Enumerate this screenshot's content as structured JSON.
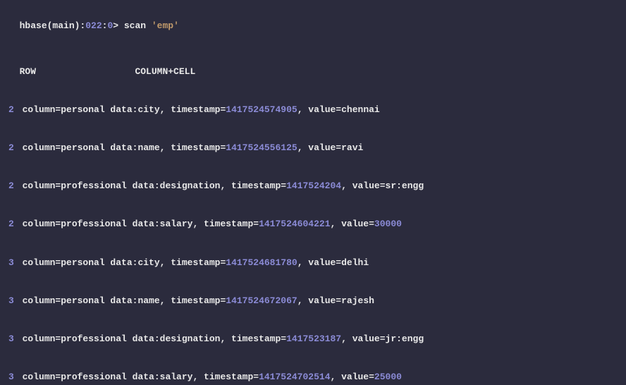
{
  "prompt": {
    "prefix": "hbase(main):",
    "seq": "022",
    "sep": ":",
    "zero": "0",
    "arrow": "> scan ",
    "arg": "'emp'"
  },
  "header": {
    "row": "ROW",
    "colcell": "COLUMN+CELL"
  },
  "rows": [
    {
      "r": "2",
      "cf": "personal data",
      "q": "city",
      "ts": "1417524574905",
      "val": "chennai",
      "valIsNum": false
    },
    {
      "r": "2",
      "cf": "personal data",
      "q": "name",
      "ts": "1417524556125",
      "val": "ravi",
      "valIsNum": false
    },
    {
      "r": "2",
      "cf": "professional data",
      "q": "designation",
      "ts": "1417524204",
      "val": "sr:engg",
      "valIsNum": false
    },
    {
      "r": "2",
      "cf": "professional data",
      "q": "salary",
      "ts": "1417524604221",
      "val": "30000",
      "valIsNum": true
    },
    {
      "r": "3",
      "cf": "personal data",
      "q": "city",
      "ts": "1417524681780",
      "val": "delhi",
      "valIsNum": false
    },
    {
      "r": "3",
      "cf": "personal data",
      "q": "name",
      "ts": "1417524672067",
      "val": "rajesh",
      "valIsNum": false
    },
    {
      "r": "3",
      "cf": "professional data",
      "q": "designation",
      "ts": "1417523187",
      "val": "jr:engg",
      "valIsNum": false
    },
    {
      "r": "3",
      "cf": "professional data",
      "q": "salary",
      "ts": "1417524702514",
      "val": "25000",
      "valIsNum": true
    }
  ]
}
